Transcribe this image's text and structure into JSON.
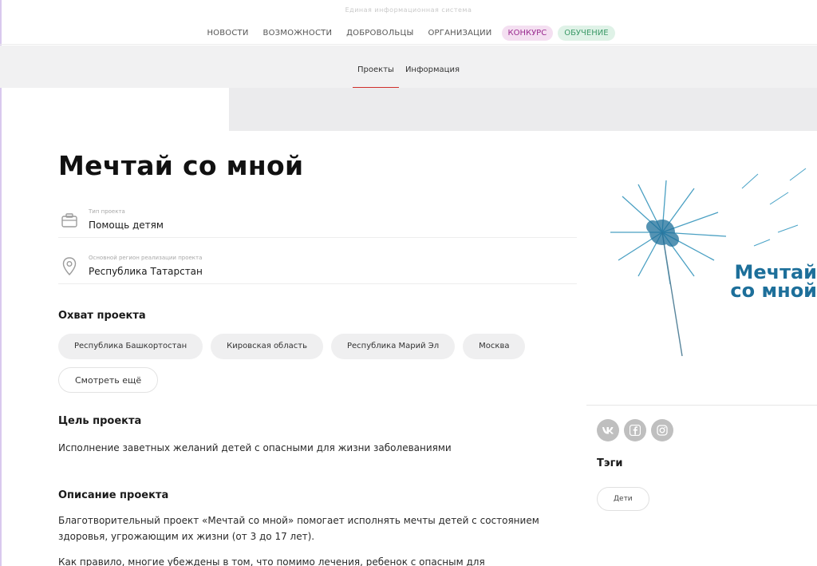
{
  "header": {
    "tagline": "Единая информационная система"
  },
  "nav": {
    "items": [
      "НОВОСТИ",
      "ВОЗМОЖНОСТИ",
      "ДОБРОВОЛЬЦЫ",
      "ОРГАНИЗАЦИИ"
    ],
    "konkurs_label": "КОНКУРС",
    "obuchenie_label": "ОБУЧЕНИЕ"
  },
  "subnav": {
    "projects_label": "Проекты",
    "info_label": "Информация"
  },
  "project": {
    "title": "Мечтай со мной",
    "type_label": "Тип проекта",
    "type_value": "Помощь детям",
    "region_label": "Основной регион реализации проекта",
    "region_value": "Республика Татарстан"
  },
  "coverage": {
    "title": "Охват проекта",
    "regions": [
      "Республика Башкортостан",
      "Кировская область",
      "Республика Марий Эл",
      "Москва"
    ],
    "more_label": "Смотреть ещё"
  },
  "goal": {
    "title": "Цель проекта",
    "text": "Исполнение заветных желаний детей с опасными для жизни заболеваниями"
  },
  "description": {
    "title": "Описание проекта",
    "para1": "Благотворительный проект «Мечтай со мной» помогает исполнять мечты детей с состоянием здоровья, угрожающим их жизни (от 3 до 17 лет).",
    "para2": "Как правило, многие убеждены в том, что помимо лечения, ребенок с опасным для"
  },
  "logo": {
    "line1": "Мечтай",
    "line2": "со мной",
    "color": "#1d6f9a"
  },
  "sidebar": {
    "social": [
      "vk-icon",
      "facebook-icon",
      "instagram-icon"
    ],
    "tags_title": "Тэги",
    "tags": [
      "Дети"
    ]
  }
}
